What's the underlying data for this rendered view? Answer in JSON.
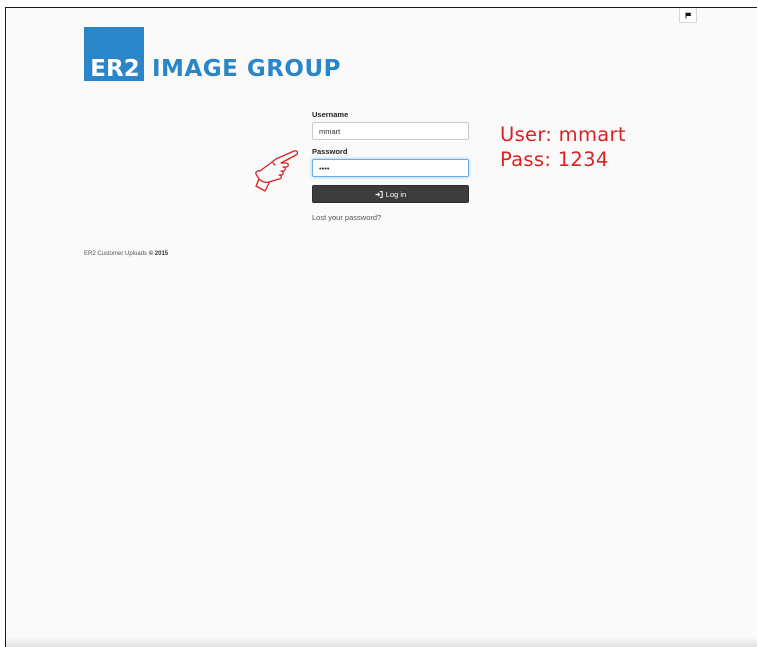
{
  "brand": {
    "logo_box_text": "ER2",
    "logo_text": "IMAGE GROUP",
    "color": "#2a86c9"
  },
  "header": {
    "flag_icon": "flag-icon"
  },
  "login": {
    "username_label": "Username",
    "username_value": "mmart",
    "password_label": "Password",
    "password_value": "1234",
    "login_button_label": "Log in",
    "login_icon": "sign-in-icon",
    "lost_password_link": "Lost your password?"
  },
  "annotation": {
    "user_line": "User: mmart",
    "pass_line": "Pass: 1234",
    "pointer_icon": "pointing-hand-icon",
    "color": "#d92323"
  },
  "footer": {
    "text": "ER2 Customer Uploads",
    "copyright": "© 2015",
    "small_text": "···"
  }
}
